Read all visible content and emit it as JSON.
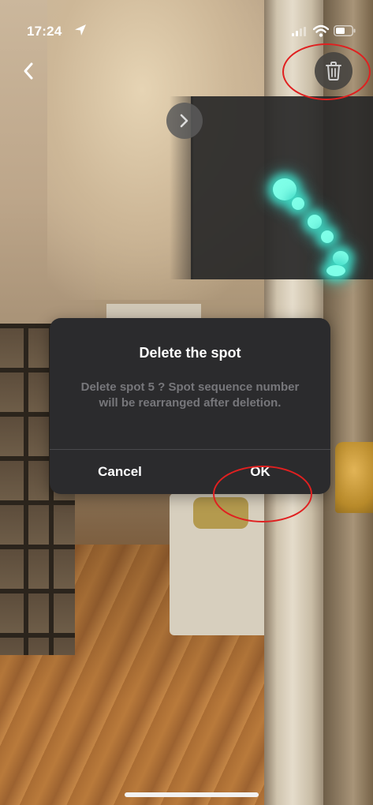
{
  "status_bar": {
    "time": "17:24",
    "location_icon": "location-arrow-icon",
    "signal_icon": "cellular-signal-icon",
    "wifi_icon": "wifi-icon",
    "battery_icon": "battery-icon"
  },
  "top_bar": {
    "back_icon": "chevron-left-icon",
    "delete_icon": "trash-icon"
  },
  "minimap": {
    "toggle_icon": "chevron-right-icon",
    "spot_color": "#40e0c8"
  },
  "dialog": {
    "title": "Delete the spot",
    "message": "Delete spot 5 ? Spot sequence number will be rearranged after deletion.",
    "cancel_label": "Cancel",
    "ok_label": "OK"
  },
  "annotations": {
    "color": "#e02020",
    "highlighted": [
      "trash-button",
      "ok-button"
    ]
  }
}
